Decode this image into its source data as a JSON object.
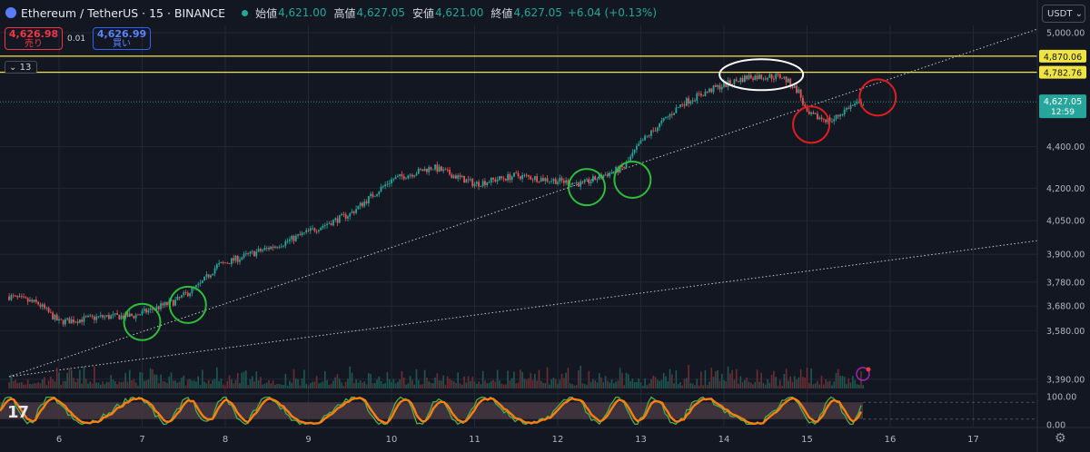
{
  "header": {
    "symbol": "Ethereum / TetherUS · 15 · BINANCE",
    "open_label": "始値",
    "open": "4,621.00",
    "high_label": "高値",
    "high": "4,627.05",
    "low_label": "安値",
    "low": "4,621.00",
    "close_label": "終値",
    "close": "4,627.05",
    "change": "+6.04 (+0.13%)"
  },
  "trade": {
    "sell_price": "4,626.98",
    "sell_label": "売り",
    "spread": "0.01",
    "buy_price": "4,626.99",
    "buy_label": "買い"
  },
  "indicator_toggle": "13",
  "currency_button": "USDT",
  "colors": {
    "background": "#131722",
    "up": "#26a69a",
    "down": "#ef5350",
    "level_line": "#f0e442",
    "green_circle": "#2ebd3a",
    "red_circle": "#e01e1e",
    "white_ellipse": "#ffffff",
    "stoch_k": "#4caf50",
    "stoch_d": "#ff7f0e",
    "osc_band": "#4a3a44"
  },
  "chart_data": {
    "type": "candlestick",
    "timeframe": "15",
    "x_ticks": [
      "6",
      "7",
      "8",
      "9",
      "10",
      "11",
      "12",
      "13",
      "14",
      "15",
      "16",
      "17"
    ],
    "y_ticks": [
      "5,000.00",
      "4,400.00",
      "4,200.00",
      "4,050.00",
      "3,900.00",
      "3,780.00",
      "3,680.00",
      "3,580.00",
      "3,390.00"
    ],
    "y_scale": "log",
    "ylim": [
      3300,
      5200
    ],
    "price_path": [
      {
        "x": 5.4,
        "y": 3720
      },
      {
        "x": 5.75,
        "y": 3690
      },
      {
        "x": 6.0,
        "y": 3615
      },
      {
        "x": 6.5,
        "y": 3635
      },
      {
        "x": 6.9,
        "y": 3640
      },
      {
        "x": 7.4,
        "y": 3700
      },
      {
        "x": 7.7,
        "y": 3770
      },
      {
        "x": 7.9,
        "y": 3850
      },
      {
        "x": 8.3,
        "y": 3900
      },
      {
        "x": 8.7,
        "y": 3950
      },
      {
        "x": 9.0,
        "y": 4000
      },
      {
        "x": 9.5,
        "y": 4080
      },
      {
        "x": 10.0,
        "y": 4240
      },
      {
        "x": 10.5,
        "y": 4300
      },
      {
        "x": 11.0,
        "y": 4220
      },
      {
        "x": 11.5,
        "y": 4260
      },
      {
        "x": 11.9,
        "y": 4240
      },
      {
        "x": 12.3,
        "y": 4220
      },
      {
        "x": 12.8,
        "y": 4300
      },
      {
        "x": 13.0,
        "y": 4420
      },
      {
        "x": 13.5,
        "y": 4620
      },
      {
        "x": 13.9,
        "y": 4700
      },
      {
        "x": 14.3,
        "y": 4760
      },
      {
        "x": 14.7,
        "y": 4760
      },
      {
        "x": 14.9,
        "y": 4680
      },
      {
        "x": 15.0,
        "y": 4560
      },
      {
        "x": 15.3,
        "y": 4530
      },
      {
        "x": 15.5,
        "y": 4600
      },
      {
        "x": 15.7,
        "y": 4627
      }
    ],
    "horizontal_levels": [
      {
        "price": 4870.06,
        "label": "4,870.06"
      },
      {
        "price": 4782.76,
        "label": "4,782.76"
      }
    ],
    "last_price": {
      "label": "4,627.05",
      "countdown": "12:59",
      "price": 4627.05
    },
    "trend_lines": [
      {
        "from": {
          "x": 5.4,
          "y": 3400
        },
        "to": {
          "x": 18.0,
          "y": 5020
        }
      },
      {
        "from": {
          "x": 5.4,
          "y": 3400
        },
        "to": {
          "x": 18.0,
          "y": 3960
        }
      }
    ],
    "annotations": [
      {
        "shape": "circle",
        "color": "green",
        "x": 7.0,
        "y": 3615
      },
      {
        "shape": "circle",
        "color": "green",
        "x": 7.55,
        "y": 3685
      },
      {
        "shape": "circle",
        "color": "green",
        "x": 12.35,
        "y": 4205
      },
      {
        "shape": "circle",
        "color": "green",
        "x": 12.9,
        "y": 4240
      },
      {
        "shape": "ellipse",
        "color": "white",
        "x": 14.45,
        "y": 4770
      },
      {
        "shape": "circle",
        "color": "red",
        "x": 15.05,
        "y": 4510
      },
      {
        "shape": "circle",
        "color": "red",
        "x": 15.85,
        "y": 4650
      }
    ],
    "oscillator": {
      "y_ticks": [
        "100.00",
        "0.00"
      ],
      "ylim": [
        0,
        100
      ],
      "band": [
        20,
        80
      ]
    },
    "volume_present": true
  }
}
